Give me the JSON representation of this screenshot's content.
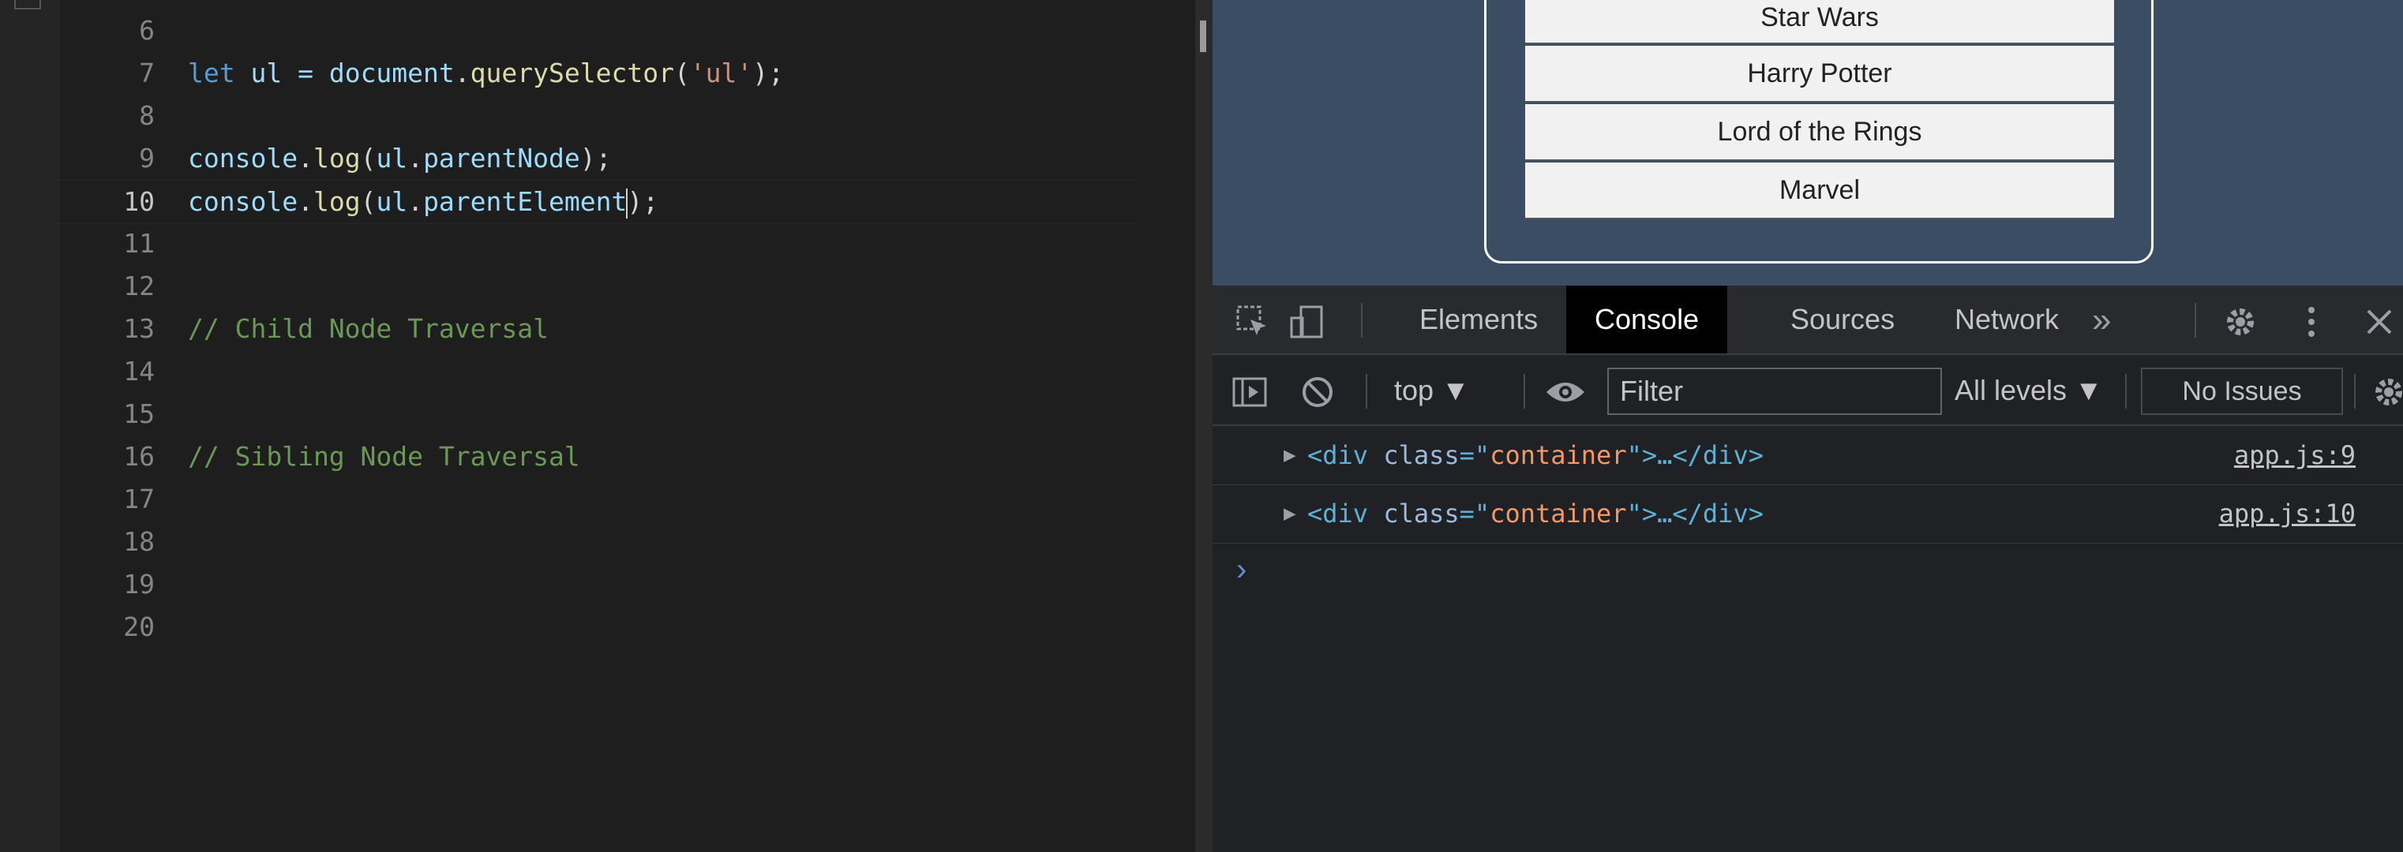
{
  "editor": {
    "lines": [
      {
        "num": "6",
        "code": ""
      },
      {
        "num": "7",
        "code": "let ul = document.querySelector('ul');"
      },
      {
        "num": "8",
        "code": ""
      },
      {
        "num": "9",
        "code": "console.log(ul.parentNode);"
      },
      {
        "num": "10",
        "code": "console.log(ul.parentElement);"
      },
      {
        "num": "11",
        "code": ""
      },
      {
        "num": "12",
        "code": ""
      },
      {
        "num": "13",
        "code": "// Child Node Traversal"
      },
      {
        "num": "14",
        "code": ""
      },
      {
        "num": "15",
        "code": ""
      },
      {
        "num": "16",
        "code": "// Sibling Node Traversal"
      },
      {
        "num": "17",
        "code": ""
      },
      {
        "num": "18",
        "code": ""
      },
      {
        "num": "19",
        "code": ""
      },
      {
        "num": "20",
        "code": ""
      }
    ],
    "tokens": {
      "l7_kw": "let",
      "l7_var": " ul = ",
      "l7_doc": "document",
      "l7_dot": ".",
      "l7_fn": "querySelector",
      "l7_open": "(",
      "l7_str": "'ul'",
      "l7_close": ");",
      "l9_obj": "console",
      "l9_dot": ".",
      "l9_fn": "log",
      "l9_open": "(",
      "l9_var": "ul",
      "l9_dot2": ".",
      "l9_prop": "parentNode",
      "l9_close": ");",
      "l10_obj": "console",
      "l10_dot": ".",
      "l10_fn": "log",
      "l10_open": "(",
      "l10_var": "ul",
      "l10_dot2": ".",
      "l10_prop": "parentElement",
      "l10_close": ");",
      "l13": "// Child Node Traversal",
      "l16": "// Sibling Node Traversal"
    }
  },
  "page": {
    "list_items": [
      "Star Wars",
      "Harry Potter",
      "Lord of the Rings",
      "Marvel"
    ]
  },
  "devtools": {
    "tabs": [
      "Elements",
      "Console",
      "Sources",
      "Network"
    ],
    "more_tabs": "»",
    "context": "top ▼",
    "filter_placeholder": "Filter",
    "levels": "All levels ▼",
    "issues": "No Issues",
    "logs": [
      {
        "open": "<div ",
        "attr": "class",
        "eq": "=\"",
        "val": "container",
        "rest": "\">…</div>",
        "source": "app.js:9"
      },
      {
        "open": "<div ",
        "attr": "class",
        "eq": "=\"",
        "val": "container",
        "rest": "\">…</div>",
        "source": "app.js:10"
      }
    ],
    "prompt": "›"
  },
  "colors": {
    "accent": "#569cd6",
    "string": "#ce9178",
    "comment": "#6a9955"
  }
}
